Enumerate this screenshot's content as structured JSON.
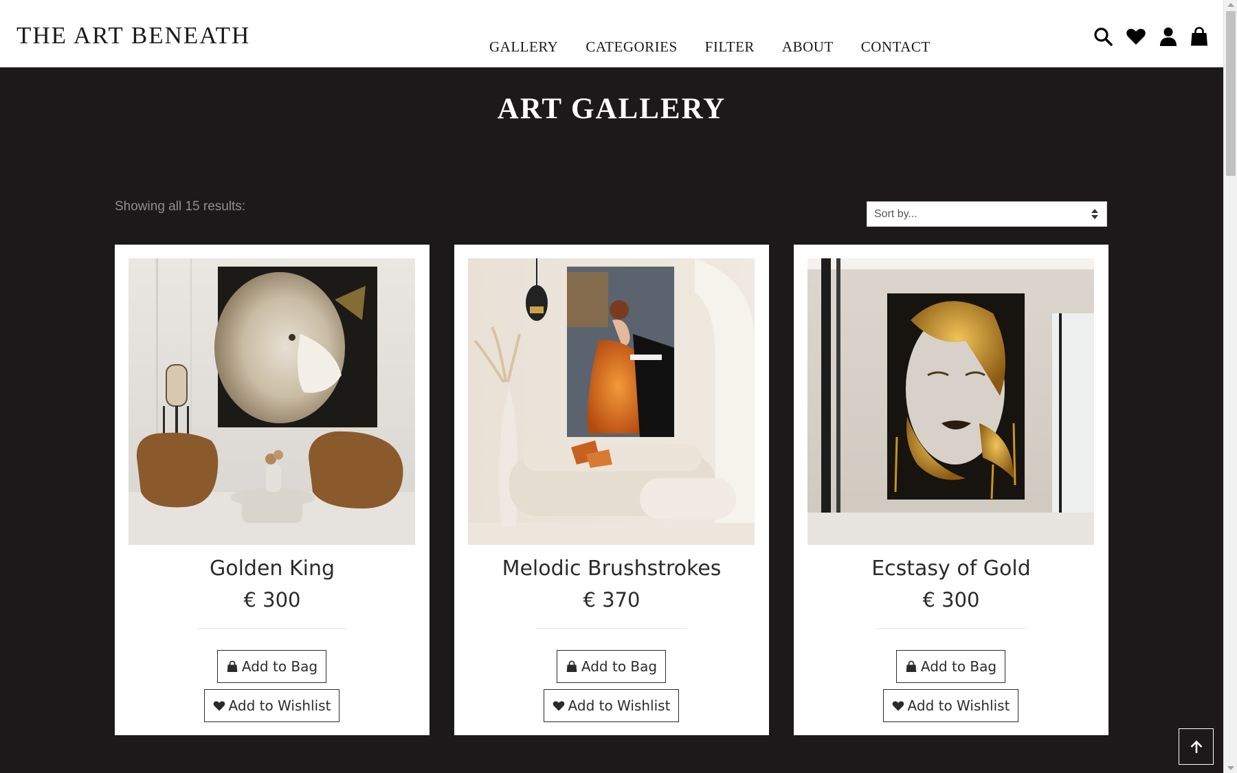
{
  "header": {
    "logo": "THE ART BENEATH",
    "nav": [
      {
        "label": "GALLERY"
      },
      {
        "label": "CATEGORIES"
      },
      {
        "label": "FILTER"
      },
      {
        "label": "ABOUT"
      },
      {
        "label": "CONTACT"
      }
    ],
    "icons": [
      "search-icon",
      "heart-icon",
      "user-icon",
      "shopping-bag-icon"
    ]
  },
  "main": {
    "title": "ART GALLERY",
    "results_text": "Showing all 15 results:",
    "sort": {
      "selected": "Sort by..."
    }
  },
  "products": [
    {
      "title": "Golden King",
      "price": "€ 300",
      "add_to_bag": "Add to Bag",
      "add_to_wishlist": "Add to Wishlist",
      "image": "lion-painting-living-room"
    },
    {
      "title": "Melodic Brushstrokes",
      "price": "€ 370",
      "add_to_bag": "Add to Bag",
      "add_to_wishlist": "Add to Wishlist",
      "image": "pianist-painting-living-room"
    },
    {
      "title": "Ecstasy of Gold",
      "price": "€ 300",
      "add_to_bag": "Add to Bag",
      "add_to_wishlist": "Add to Wishlist",
      "image": "gold-face-painting-hallway"
    }
  ],
  "colors": {
    "page_background": "#1b191a",
    "header_background": "#ffffff",
    "text_dark": "#2b2b2b",
    "muted_text": "#8f8f8f"
  },
  "back_to_top_icon": "arrow-up-icon"
}
